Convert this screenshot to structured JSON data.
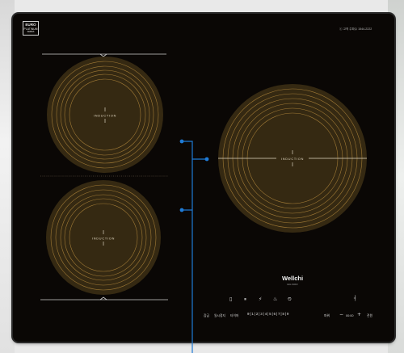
{
  "logo": {
    "line1": "EURO",
    "line2": "PLATINUM",
    "line3": "SERIES"
  },
  "top_right_text": "ⓒ 고객 주파수 1544-2222",
  "zones": [
    {
      "label": "INDUCTION"
    },
    {
      "label": "INDUCTION"
    },
    {
      "label": "INDUCTION"
    }
  ],
  "brand": {
    "name": "Wellchi",
    "model": "EIH-M4D3"
  },
  "controls": {
    "left_labels": [
      "잠금",
      "일시정지",
      "타이머"
    ],
    "power_levels": "0|1|2|3|4|5|6|7|8|9",
    "right_label_1": "파워",
    "minus": "−",
    "timer_display": "00:00",
    "plus": "+",
    "right_label_2": "전원"
  },
  "icons": [
    "lock-icon",
    "pause-icon",
    "power-boost-icon",
    "warm-icon",
    "timer-icon"
  ],
  "colors": {
    "glass": "#0a0705",
    "coil": "#352912",
    "coil_line": "#a07a36",
    "callout": "#1f7bd6"
  }
}
